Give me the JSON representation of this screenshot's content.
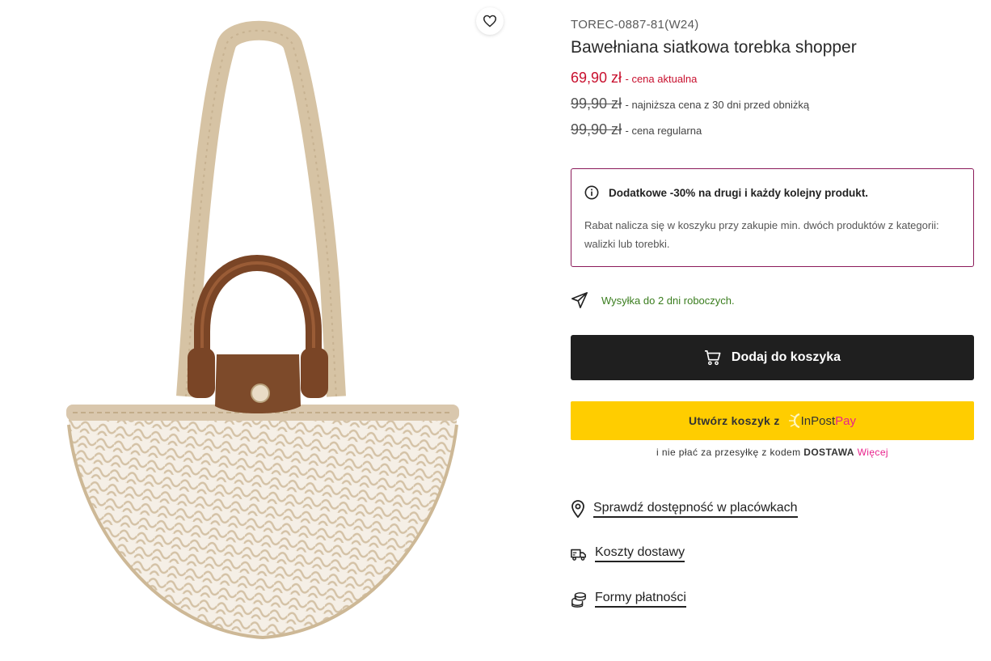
{
  "product": {
    "sku": "TOREC-0887-81(W24)",
    "title": "Bawełniana siatkowa torebka shopper",
    "image_alt": "Bawełniana siatkowa torebka shopper"
  },
  "prices": {
    "current": {
      "amount": "69,90 zł",
      "desc": "- cena aktualna"
    },
    "lowest": {
      "amount": "99,90 zł",
      "desc": "- najniższa cena z 30 dni przed obniżką"
    },
    "regular": {
      "amount": "99,90 zł",
      "desc": "- cena regularna"
    }
  },
  "promo": {
    "title": "Dodatkowe -30% na drugi i każdy kolejny produkt.",
    "text": "Rabat nalicza się w koszyku przy zakupie min. dwóch produktów z kategorii: walizki lub torebki."
  },
  "shipping": {
    "text": "Wysyłka do 2 dni roboczych."
  },
  "cart_button": {
    "label": "Dodaj do koszyka"
  },
  "inpost": {
    "label": "Utwórz koszyk z",
    "logo_a": "InPost",
    "logo_b": "Pay",
    "note_prefix": "i nie płać za przesyłkę z kodem",
    "code": "DOSTAWA",
    "more_link": "Więcej"
  },
  "links": {
    "stores": "Sprawdź dostępność w placówkach",
    "delivery": "Koszty dostawy",
    "payment": "Formy płatności"
  },
  "colors": {
    "price_red": "#c8102e",
    "promo_border": "#8b1a5a",
    "shipping_green": "#3a7d1e",
    "inpost_yellow": "#ffcd00",
    "accent_pink": "#e9228c",
    "bag_beige": "#d9c7ad",
    "leather_brown": "#7a4526"
  },
  "icons": {
    "favorite": "heart-icon",
    "info": "info-icon",
    "shipping": "paper-plane-icon",
    "cart": "cart-icon",
    "inpost": "sun-icon",
    "stores": "map-pin-icon",
    "delivery": "truck-icon",
    "payment": "coins-icon"
  }
}
